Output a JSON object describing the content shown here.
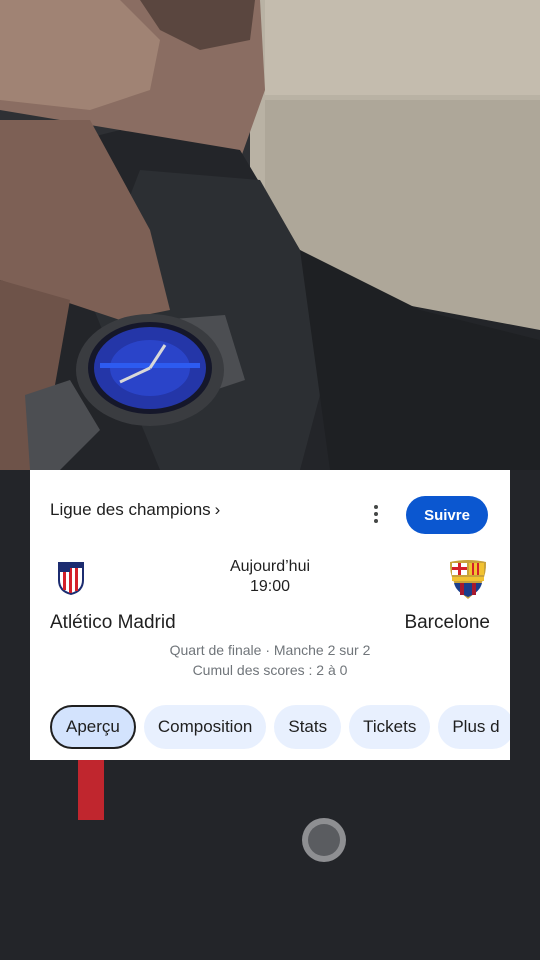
{
  "background": {
    "scene": "person-wearing-watch-photo"
  },
  "card": {
    "league_label": "Ligue des champions",
    "more_icon": "more-vert-icon",
    "follow_label": "Suivre",
    "accent_color": "#0b57d0",
    "match": {
      "date": "Aujourd’hui",
      "time": "19:00",
      "home_team": "Atlético Madrid",
      "away_team": "Barcelone",
      "home_crest": "atletico-madrid-crest-icon",
      "away_crest": "fc-barcelona-crest-icon",
      "stage": "Quart de finale · Manche 2 sur 2",
      "aggregate": "Cumul des scores : 2 à 0"
    },
    "tabs": [
      {
        "label": "Aperçu",
        "active": true
      },
      {
        "label": "Composition",
        "active": false
      },
      {
        "label": "Stats",
        "active": false
      },
      {
        "label": "Tickets",
        "active": false
      },
      {
        "label": "Plus d",
        "active": false
      }
    ]
  }
}
